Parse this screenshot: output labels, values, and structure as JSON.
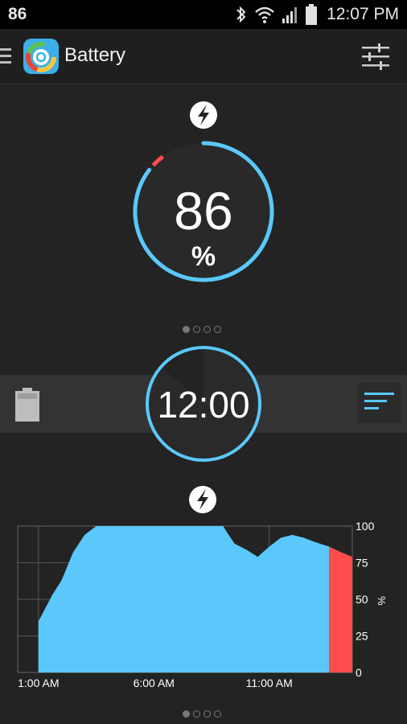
{
  "status_bar": {
    "battery_level": "86",
    "time": "12:07 PM",
    "icons": [
      "bluetooth-icon",
      "wifi-icon",
      "signal-icon",
      "battery-status-icon"
    ]
  },
  "action_bar": {
    "title": "Battery",
    "icons": [
      "menu-icon",
      "app-icon",
      "settings-sliders-icon"
    ]
  },
  "gauge": {
    "value": "86",
    "unit": "%",
    "charging_icon": "lightning-icon",
    "level_fraction": 0.86,
    "colors": {
      "ring": "#5ac8fa",
      "low": "#ff4c4c"
    }
  },
  "pager_top": {
    "pages": 4,
    "active": 0
  },
  "clock": {
    "time": "12:00"
  },
  "strip": {
    "icons": [
      "battery-icon",
      "list-view-icon"
    ]
  },
  "chart_charging_icon": "lightning-icon",
  "chart_data": {
    "type": "area",
    "x_tick_labels": [
      "1:00 AM",
      "6:00 AM",
      "11:00 AM"
    ],
    "y_tick_labels": [
      "100",
      "75",
      "50",
      "25",
      "0"
    ],
    "ylabel": "%",
    "ylim": [
      0,
      100
    ],
    "grid": true,
    "series": [
      {
        "color": "#5ac8fa",
        "x_hours": [
          0,
          0.6,
          1.0,
          1.5,
          2.0,
          2.5,
          3.0,
          3.5,
          4.0,
          4.5,
          5.0,
          5.5,
          6.0,
          6.5,
          7.0,
          7.5,
          8.0,
          8.2,
          8.5,
          9.0,
          9.5,
          10.0,
          10.5,
          11.0,
          11.5,
          12.0,
          12.6
        ],
        "values": [
          35,
          53,
          63,
          82,
          94,
          100,
          100,
          100,
          100,
          100,
          100,
          100,
          100,
          100,
          100,
          100,
          100,
          95,
          88,
          84,
          79,
          86,
          92,
          94,
          92,
          89,
          86
        ]
      },
      {
        "color": "#ff4c4c",
        "x_hours": [
          12.6,
          13.0,
          13.6
        ],
        "values": [
          86,
          83,
          79
        ]
      }
    ],
    "x_domain_hours": [
      -0.9,
      13.6
    ]
  },
  "pager_bottom": {
    "pages": 4,
    "active": 0
  }
}
